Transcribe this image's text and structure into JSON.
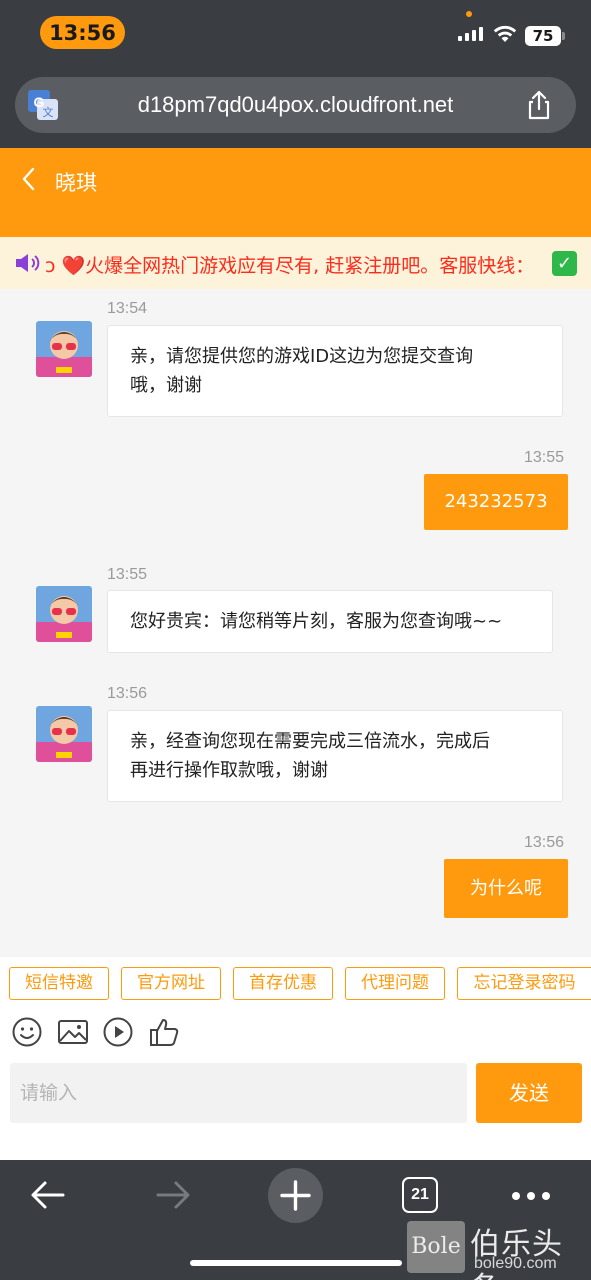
{
  "status_bar": {
    "time": "13:56",
    "battery": "75"
  },
  "browser": {
    "url": "d18pm7qd0u4pox.cloudfront.net",
    "tab_count": "21",
    "icons": [
      "translate-icon",
      "share-icon",
      "back-arrow-icon",
      "forward-arrow-icon",
      "plus-icon",
      "tabs-icon",
      "more-icon"
    ]
  },
  "chat": {
    "title": "晓琪",
    "marquee": "ↄ ❤️火爆全网热门游戏应有尽有, 赶紧注册吧。客服快线：",
    "messages": [
      {
        "from": "agent",
        "time": "13:54",
        "lines": [
          "亲，请您提供您的游戏ID这边为您提交查询",
          "哦，谢谢"
        ]
      },
      {
        "from": "user",
        "time": "13:55",
        "text": "243232573"
      },
      {
        "from": "agent",
        "time": "13:55",
        "lines": [
          "您好贵宾：请您稍等片刻，客服为您查询哦~~"
        ]
      },
      {
        "from": "agent",
        "time": "13:56",
        "lines": [
          "亲，经查询您现在需要完成三倍流水，完成后",
          "再进行操作取款哦，谢谢"
        ]
      },
      {
        "from": "user",
        "time": "13:56",
        "text": "为什么呢"
      }
    ],
    "quick_buttons": [
      "短信特邀",
      "官方网址",
      "首存优惠",
      "代理问题",
      "忘记登录密码"
    ],
    "toolbar_icons": [
      "emoji-icon",
      "image-icon",
      "video-icon",
      "thumbs-up-icon"
    ],
    "input_placeholder": "请输入",
    "send_label": "发送"
  },
  "watermark": {
    "logo": "Bole",
    "name": "伯乐头条",
    "site": "bole90.com"
  },
  "colors": {
    "accent": "#ff9a0e",
    "chrome": "#3a3d42",
    "marquee_text": "#ff2a1a",
    "marquee_bg": "#fdf3da"
  }
}
